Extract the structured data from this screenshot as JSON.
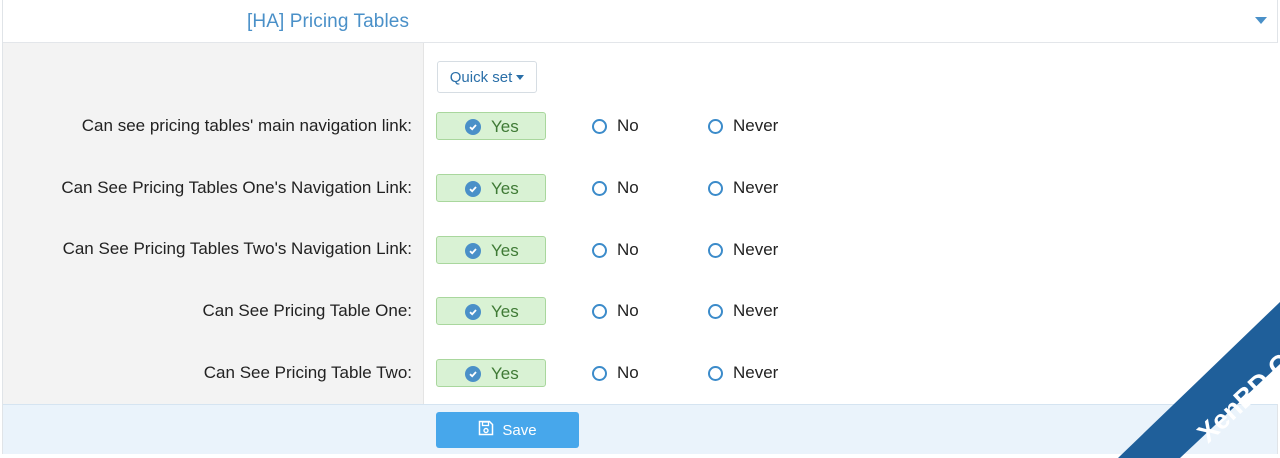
{
  "section": {
    "title": "[HA] Pricing Tables",
    "toggle_icon": "caret-down-icon"
  },
  "quick_set": {
    "label": "Quick set"
  },
  "permissions": [
    {
      "label": "Can see pricing tables' main navigation link:",
      "options": [
        "Yes",
        "No",
        "Never"
      ],
      "selected": "Yes"
    },
    {
      "label": "Can See Pricing Tables One's Navigation Link:",
      "options": [
        "Yes",
        "No",
        "Never"
      ],
      "selected": "Yes"
    },
    {
      "label": "Can See Pricing Tables Two's Navigation Link:",
      "options": [
        "Yes",
        "No",
        "Never"
      ],
      "selected": "Yes"
    },
    {
      "label": "Can See Pricing Table One:",
      "options": [
        "Yes",
        "No",
        "Never"
      ],
      "selected": "Yes"
    },
    {
      "label": "Can See Pricing Table Two:",
      "options": [
        "Yes",
        "No",
        "Never"
      ],
      "selected": "Yes"
    }
  ],
  "save": {
    "label": "Save",
    "icon": "floppy-disk-icon"
  },
  "watermark": {
    "text": "XenBD.Com"
  },
  "colors": {
    "accent": "#4a90c8",
    "yes_bg": "#d9f2d4",
    "save_bg": "#47a7eb",
    "watermark": "#1f5f9a"
  }
}
